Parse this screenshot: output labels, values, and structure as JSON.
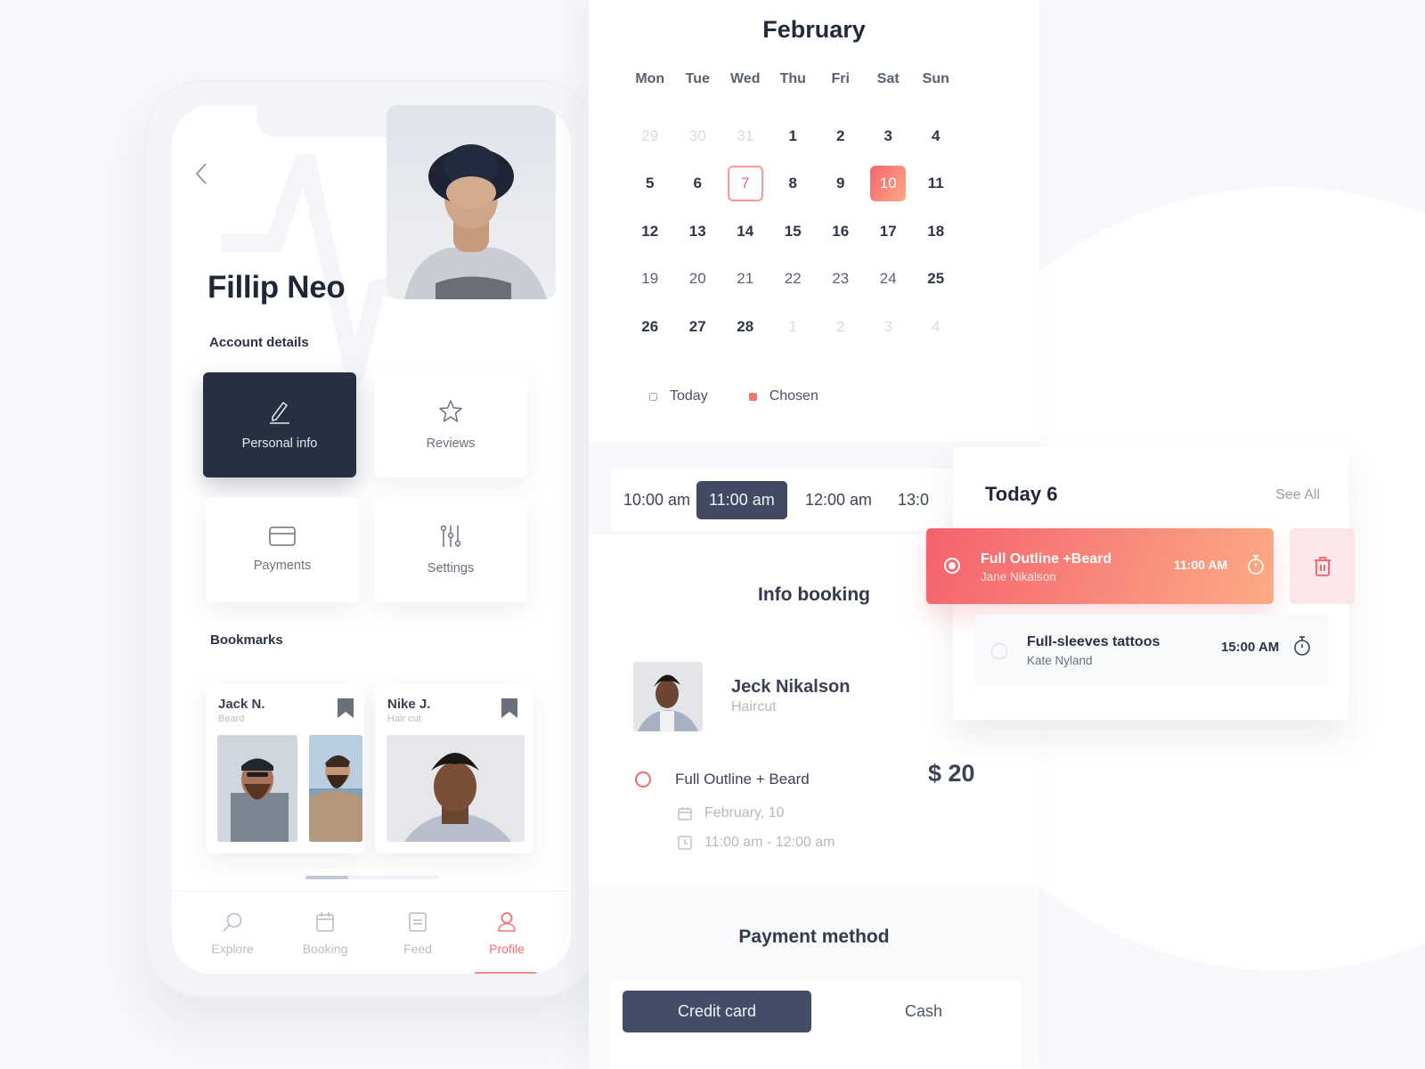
{
  "phone": {
    "profile_name": "Fillip Neo",
    "account_details_label": "Account details",
    "tiles": [
      {
        "label": "Personal info",
        "icon": "pencil-icon",
        "active": true
      },
      {
        "label": "Reviews",
        "icon": "star-icon",
        "active": false
      },
      {
        "label": "Payments",
        "icon": "credit-card-icon",
        "active": false
      },
      {
        "label": "Settings",
        "icon": "sliders-icon",
        "active": false
      }
    ],
    "bookmarks_label": "Bookmarks",
    "bookmarks": [
      {
        "name": "Jack N.",
        "service": "Beard"
      },
      {
        "name": "Nike J.",
        "service": "Hair cut"
      }
    ],
    "tabs": [
      {
        "label": "Explore",
        "icon": "search-icon",
        "active": false
      },
      {
        "label": "Booking",
        "icon": "calendar-icon",
        "active": false
      },
      {
        "label": "Feed",
        "icon": "document-icon",
        "active": false
      },
      {
        "label": "Profile",
        "icon": "user-icon",
        "active": true
      }
    ]
  },
  "calendar": {
    "month": "February",
    "weekdays": [
      "Mon",
      "Tue",
      "Wed",
      "Thu",
      "Fri",
      "Sat",
      "Sun"
    ],
    "weeks": [
      [
        {
          "d": "29",
          "s": "muted"
        },
        {
          "d": "30",
          "s": "muted"
        },
        {
          "d": "31",
          "s": "muted"
        },
        {
          "d": "1",
          "s": ""
        },
        {
          "d": "2",
          "s": ""
        },
        {
          "d": "3",
          "s": ""
        },
        {
          "d": "4",
          "s": ""
        }
      ],
      [
        {
          "d": "5",
          "s": ""
        },
        {
          "d": "6",
          "s": ""
        },
        {
          "d": "7",
          "s": "today"
        },
        {
          "d": "8",
          "s": ""
        },
        {
          "d": "9",
          "s": ""
        },
        {
          "d": "10",
          "s": "chosen"
        },
        {
          "d": "11",
          "s": ""
        }
      ],
      [
        {
          "d": "12",
          "s": ""
        },
        {
          "d": "13",
          "s": ""
        },
        {
          "d": "14",
          "s": ""
        },
        {
          "d": "15",
          "s": ""
        },
        {
          "d": "16",
          "s": ""
        },
        {
          "d": "17",
          "s": ""
        },
        {
          "d": "18",
          "s": ""
        }
      ],
      [
        {
          "d": "19",
          "s": "light"
        },
        {
          "d": "20",
          "s": "light"
        },
        {
          "d": "21",
          "s": "light"
        },
        {
          "d": "22",
          "s": "light"
        },
        {
          "d": "23",
          "s": "light"
        },
        {
          "d": "24",
          "s": "light"
        },
        {
          "d": "25",
          "s": ""
        }
      ],
      [
        {
          "d": "26",
          "s": ""
        },
        {
          "d": "27",
          "s": ""
        },
        {
          "d": "28",
          "s": ""
        },
        {
          "d": "1",
          "s": "muted"
        },
        {
          "d": "2",
          "s": "muted"
        },
        {
          "d": "3",
          "s": "muted"
        },
        {
          "d": "4",
          "s": "muted"
        }
      ]
    ],
    "legend": {
      "today": "Today",
      "chosen": "Chosen"
    }
  },
  "time_slots": [
    {
      "label": "10:00 am",
      "active": false
    },
    {
      "label": "11:00 am",
      "active": true
    },
    {
      "label": "12:00 am",
      "active": false
    },
    {
      "label": "13:0",
      "active": false
    }
  ],
  "info_booking": {
    "title": "Info booking",
    "barber_name": "Jeck Nikalson",
    "barber_role": "Haircut",
    "service": "Full Outline + Beard",
    "price": "$ 20",
    "date": "February, 10",
    "time_range": "11:00 am - 12:00  am"
  },
  "payment": {
    "title": "Payment method",
    "options": [
      {
        "label": "Credit card",
        "active": true
      },
      {
        "label": "Cash",
        "active": false
      }
    ]
  },
  "today_panel": {
    "title": "Today 6",
    "see_all": "See All",
    "appointments": [
      {
        "title": "Full Outline +Beard",
        "client": "Jane Nikalson",
        "time": "11:00 AM",
        "active": true
      },
      {
        "title": "Full-sleeves tattoos",
        "client": "Kate Nyland",
        "time": "15:00 AM",
        "active": false
      }
    ]
  },
  "colors": {
    "accent_start": "#f5616d",
    "accent_end": "#fcab86",
    "dark": "#272f42",
    "slate": "#434d66"
  }
}
